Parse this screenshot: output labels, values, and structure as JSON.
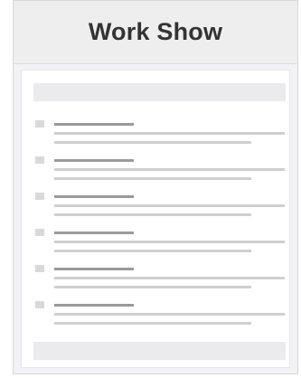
{
  "card": {
    "title": "Work Show"
  },
  "list": {
    "item_count": 6
  },
  "colors": {
    "card_background": "#f2f2f4",
    "header_background": "#eeeeef",
    "title_text": "#333333",
    "placeholder_bar": "#ebebed",
    "bullet": "#d9d9db",
    "heading_line": "#9a9a9c",
    "text_line": "#cfcfd1"
  }
}
